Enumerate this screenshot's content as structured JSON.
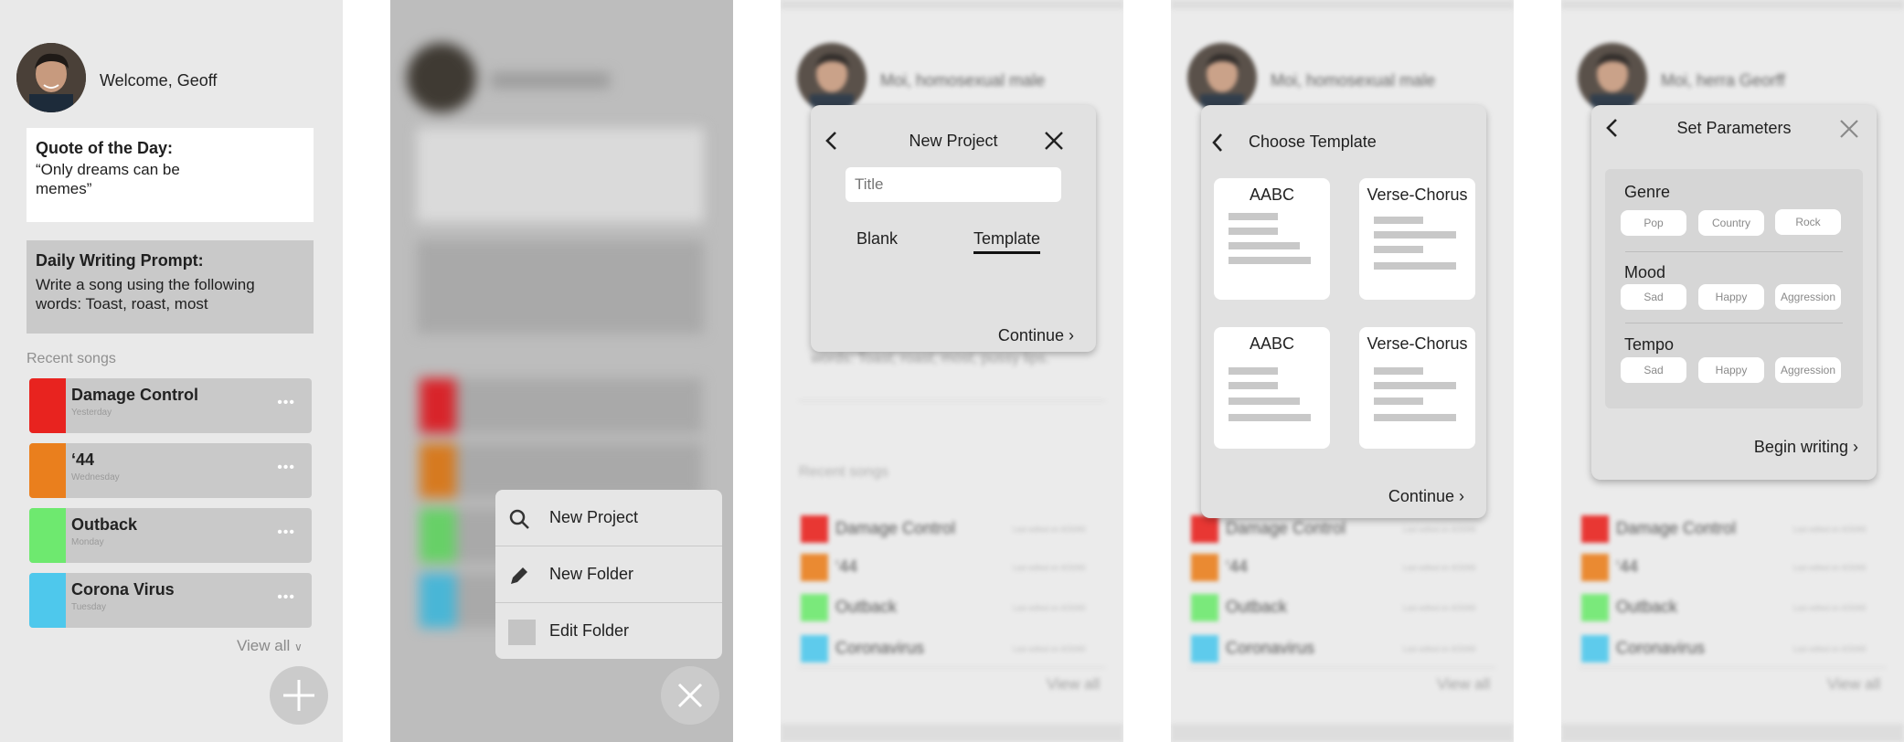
{
  "screen1": {
    "welcome": "Welcome, Geoff",
    "quote_title": "Quote of the Day:",
    "quote_text_1": "“Only dreams can be",
    "quote_text_2": "memes”",
    "prompt_title": "Daily Writing Prompt:",
    "prompt_text_1": "Write a song using the following",
    "prompt_text_2": "words: Toast, roast, most",
    "recent_label": "Recent songs",
    "songs": [
      {
        "title": "Damage Control",
        "sub": "Yesterday",
        "color": "#e8231f"
      },
      {
        "title": "‘44",
        "sub": "Wednesday",
        "color": "#ea7f1d"
      },
      {
        "title": "Outback",
        "sub": "Monday",
        "color": "#6ee96f"
      },
      {
        "title": "Corona Virus",
        "sub": "Tuesday",
        "color": "#4ec8ec"
      }
    ],
    "view_all": "View all",
    "fab_icon": "plus-icon"
  },
  "screen2": {
    "menu": [
      {
        "label": "New Project",
        "icon": "search-icon"
      },
      {
        "label": "New Folder",
        "icon": "pencil-icon"
      },
      {
        "label": "Edit Folder",
        "icon": "square-icon"
      }
    ],
    "close_icon": "close-icon"
  },
  "screen3": {
    "header": "Moi, homosexual male",
    "bg_prompt": "words: Toast, roast, most, pussy lips.",
    "modal_title": "New Project",
    "title_placeholder": "Title",
    "tab_blank": "Blank",
    "tab_template": "Template",
    "continue": "Continue",
    "recent_label": "Recent songs",
    "songs": [
      {
        "title": "Damage Control",
        "meta": "Last edited on 4/20/69",
        "color": "#e8231f"
      },
      {
        "title": "‘44",
        "meta": "Last edited on 4/20/69",
        "color": "#ea7f1d"
      },
      {
        "title": "Outback",
        "meta": "Last edited on 4/20/69",
        "color": "#6ee96f"
      },
      {
        "title": "Coronavirus",
        "meta": "Last edited on 4/20/69",
        "color": "#4ec8ec"
      }
    ],
    "view_all": "View all"
  },
  "screen4": {
    "header": "Moi, homosexual male",
    "modal_title": "Choose Template",
    "templates": [
      "AABC",
      "Verse-Chorus",
      "AABC",
      "Verse-Chorus"
    ],
    "continue": "Continue",
    "songs": [
      {
        "title": "Damage Control",
        "meta": "Last edited on 4/20/69",
        "color": "#e8231f"
      },
      {
        "title": "‘44",
        "meta": "Last edited on 4/20/69",
        "color": "#ea7f1d"
      },
      {
        "title": "Outback",
        "meta": "Last edited on 4/20/69",
        "color": "#6ee96f"
      },
      {
        "title": "Coronavirus",
        "meta": "Last edited on 4/20/69",
        "color": "#4ec8ec"
      }
    ],
    "view_all": "View all"
  },
  "screen5": {
    "header": "Moi, herra Georff",
    "modal_title": "Set Parameters",
    "genre_label": "Genre",
    "genre_options": [
      "Pop",
      "Country",
      "Rock"
    ],
    "mood_label": "Mood",
    "mood_options": [
      "Sad",
      "Happy",
      "Aggression"
    ],
    "tempo_label": "Tempo",
    "tempo_options": [
      "Sad",
      "Happy",
      "Aggression"
    ],
    "begin": "Begin writing",
    "songs": [
      {
        "title": "Damage Control",
        "meta": "Last edited on 4/20/69",
        "color": "#e8231f"
      },
      {
        "title": "‘44",
        "meta": "Last edited on 4/20/69",
        "color": "#ea7f1d"
      },
      {
        "title": "Outback",
        "meta": "Last edited on 4/20/69",
        "color": "#6ee96f"
      },
      {
        "title": "Coronavirus",
        "meta": "Last edited on 4/20/69",
        "color": "#4ec8ec"
      }
    ],
    "view_all": "View all"
  }
}
